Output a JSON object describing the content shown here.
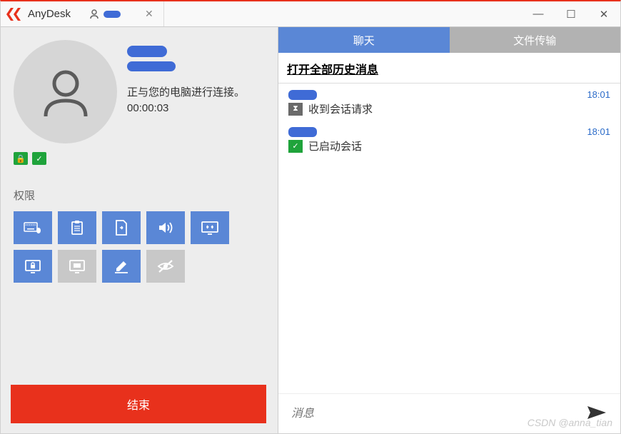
{
  "app_name": "AnyDesk",
  "connection": {
    "status_text": "正与您的电脑进行连接。",
    "timer": "00:00:03"
  },
  "permissions": {
    "label": "权限"
  },
  "end_button": "结束",
  "right_tabs": {
    "chat": "聊天",
    "file_transfer": "文件传输"
  },
  "history_link": "打开全部历史消息",
  "messages": [
    {
      "time": "18:01",
      "text": "收到会话请求",
      "icon": "hourglass"
    },
    {
      "time": "18:01",
      "text": "已启动会话",
      "icon": "check"
    }
  ],
  "message_input_placeholder": "消息",
  "watermark": "CSDN @anna_tian"
}
